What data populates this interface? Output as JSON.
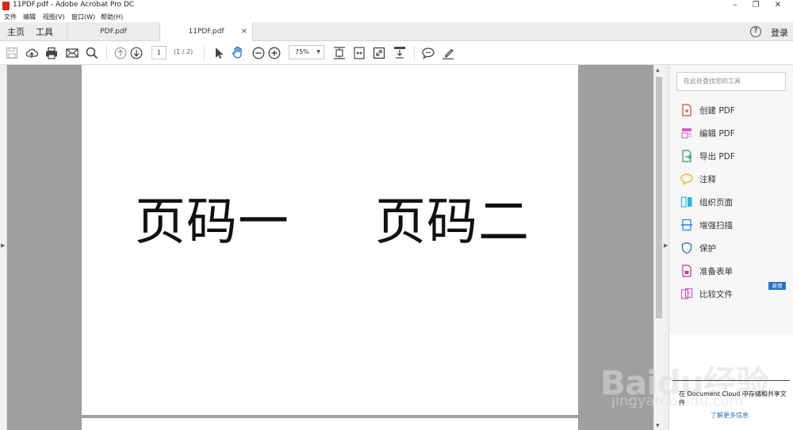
{
  "window": {
    "title": "11PDF.pdf - Adobe Acrobat Pro DC",
    "controls": {
      "minimize": "–",
      "restore": "❐",
      "close": "✕"
    }
  },
  "menubar": [
    "文件",
    "编辑",
    "视图(V)",
    "窗口(W)",
    "帮助(H)"
  ],
  "tabbar": {
    "home": "主页",
    "tools": "工具",
    "tabs": [
      {
        "label": "PDF.pdf",
        "active": false
      },
      {
        "label": "11PDF.pdf",
        "active": true,
        "close": "×"
      }
    ],
    "help": "?",
    "login": "登录"
  },
  "toolbar": {
    "icons": [
      "save-icon",
      "cloud-upload-icon",
      "print-icon",
      "email-icon",
      "search-icon",
      "previous-page-icon",
      "next-page-icon",
      "select-cursor-icon",
      "hand-tool-icon",
      "zoom-out-icon",
      "zoom-in-icon",
      "fit-page-icon",
      "fit-width-icon",
      "fullscreen-icon",
      "scroll-mode-icon",
      "comment-icon",
      "highlight-icon"
    ],
    "current_page": "1",
    "page_count": "(1 / 2)",
    "zoom": "75%"
  },
  "document": {
    "page_text_left": "页码一",
    "page_text_right": "页码二"
  },
  "tools_panel": {
    "search_placeholder": "在此处查找您的工具",
    "items": [
      {
        "label": "创建 PDF",
        "icon": "create-pdf-icon",
        "color": "#e0463d"
      },
      {
        "label": "编辑 PDF",
        "icon": "edit-pdf-icon",
        "color": "#d45fc3"
      },
      {
        "label": "导出 PDF",
        "icon": "export-pdf-icon",
        "color": "#2e9c6a"
      },
      {
        "label": "注释",
        "icon": "comment-icon",
        "color": "#f2b72b"
      },
      {
        "label": "组织页面",
        "icon": "organize-pages-icon",
        "color": "#2fb3d9"
      },
      {
        "label": "增强扫描",
        "icon": "enhance-scan-icon",
        "color": "#2f7fd9"
      },
      {
        "label": "保护",
        "icon": "protect-shield-icon",
        "color": "#2f6fc9"
      },
      {
        "label": "准备表单",
        "icon": "prepare-form-icon",
        "color": "#b33f9c"
      },
      {
        "label": "比较文件",
        "icon": "compare-files-icon",
        "color": "#d45fc3"
      }
    ],
    "new_badge": "新增",
    "promo_text": "在 Document Cloud 中存储和共享文件",
    "promo_link": "了解更多信息"
  },
  "watermark": {
    "logo": "Baidu经验",
    "sub": "jingyan.baidu.com"
  }
}
